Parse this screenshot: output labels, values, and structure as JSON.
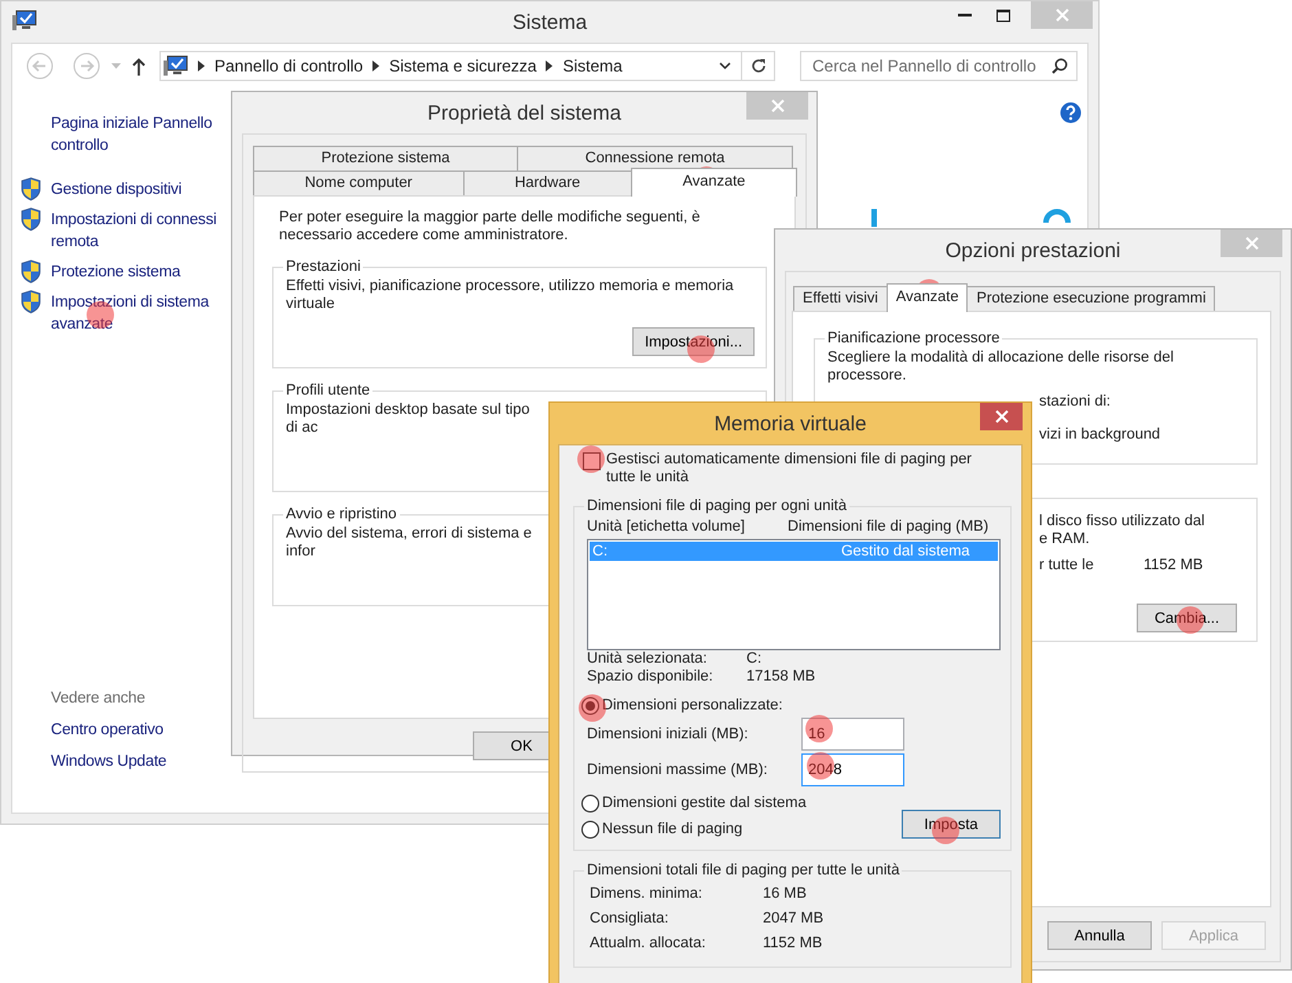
{
  "system_window": {
    "title": "Sistema",
    "breadcrumb": [
      "Pannello di controllo",
      "Sistema e sicurezza",
      "Sistema"
    ],
    "search": {
      "placeholder": "Cerca nel Pannello di controllo"
    },
    "home_link": {
      "lines": [
        "Pagina iniziale Pannello",
        "controllo"
      ]
    },
    "tasks": [
      {
        "lines": [
          "Gestione dispositivi"
        ]
      },
      {
        "lines": [
          "Impostazioni di connessi",
          "remota"
        ]
      },
      {
        "lines": [
          "Protezione sistema"
        ]
      },
      {
        "lines": [
          "Impostazioni di sistema",
          "avanzate"
        ]
      }
    ],
    "see_also": {
      "heading": "Vedere anche",
      "links": [
        "Centro operativo",
        "Windows Update"
      ]
    }
  },
  "system_properties": {
    "title": "Proprietà del sistema",
    "tab_rows": [
      {
        "tabs": [
          {
            "label": "Protezione sistema",
            "selected": false
          },
          {
            "label": "Connessione remota",
            "selected": false
          }
        ]
      },
      {
        "tabs": [
          {
            "label": "Nome computer",
            "selected": false
          },
          {
            "label": "Hardware",
            "selected": false
          },
          {
            "label": "Avanzate",
            "selected": true
          }
        ]
      }
    ],
    "notice": "Per poter eseguire la maggior parte delle modifiche seguenti, è necessario accedere come amministratore.",
    "groups": [
      {
        "legend": "Prestazioni",
        "text": "Effetti visivi, pianificazione processore, utilizzo memoria e memoria virtuale",
        "button": "Impostazioni..."
      },
      {
        "legend": "Profili utente",
        "text": "Impostazioni desktop basate sul tipo di ac"
      },
      {
        "legend": "Avvio e ripristino",
        "text": "Avvio del sistema, errori di sistema e infor"
      }
    ],
    "buttons": [
      "OK"
    ]
  },
  "performance_options": {
    "title": "Opzioni prestazioni",
    "tabs": [
      {
        "label": "Effetti visivi",
        "selected": false
      },
      {
        "label": "Avanzate",
        "selected": true
      },
      {
        "label": "Protezione esecuzione programmi",
        "selected": false
      }
    ],
    "scheduling": {
      "legend": "Pianificazione processore",
      "text": "Scegliere la modalità di allocazione delle risorse del processore.",
      "fragments": [
        "stazioni di:",
        "vizi in background"
      ]
    },
    "memory": {
      "fragments": [
        "l disco fisso utilizzato dal",
        "e RAM."
      ],
      "total_label": "r tutte le",
      "total_value": "1152 MB",
      "button": "Cambia..."
    },
    "buttons": [
      {
        "label": "Annulla",
        "disabled": false
      },
      {
        "label": "Applica",
        "disabled": true
      }
    ]
  },
  "virtual_memory": {
    "title": "Memoria virtuale",
    "auto_manage": {
      "label": "Gestisci automaticamente dimensioni file di paging per tutte le unità",
      "checked": false
    },
    "drives_group": {
      "legend": "Dimensioni file di paging per ogni unità",
      "columns": [
        "Unità [etichetta volume]",
        "Dimensioni file di paging (MB)"
      ],
      "rows": [
        {
          "drive": "C:",
          "size": "Gestito dal sistema",
          "selected": true
        }
      ],
      "info": [
        {
          "label": "Unità selezionata:",
          "value": "C:"
        },
        {
          "label": "Spazio disponibile:",
          "value": "17158 MB"
        }
      ],
      "size_options": [
        {
          "label": "Dimensioni personalizzate:",
          "selected": true,
          "fields": [
            {
              "label": "Dimensioni iniziali (MB):",
              "value": "16",
              "focused": false
            },
            {
              "label": "Dimensioni massime (MB):",
              "value": "2048",
              "focused": true
            }
          ]
        },
        {
          "label": "Dimensioni gestite dal sistema",
          "selected": false
        },
        {
          "label": "Nessun file di paging",
          "selected": false
        }
      ],
      "set_button": "Imposta"
    },
    "totals_group": {
      "legend": "Dimensioni totali file di paging per tutte le unità",
      "rows": [
        {
          "label": "Dimens. minima:",
          "value": "16 MB"
        },
        {
          "label": "Consigliata:",
          "value": "2047 MB"
        },
        {
          "label": "Attualm. allocata:",
          "value": "1152 MB"
        }
      ]
    }
  }
}
